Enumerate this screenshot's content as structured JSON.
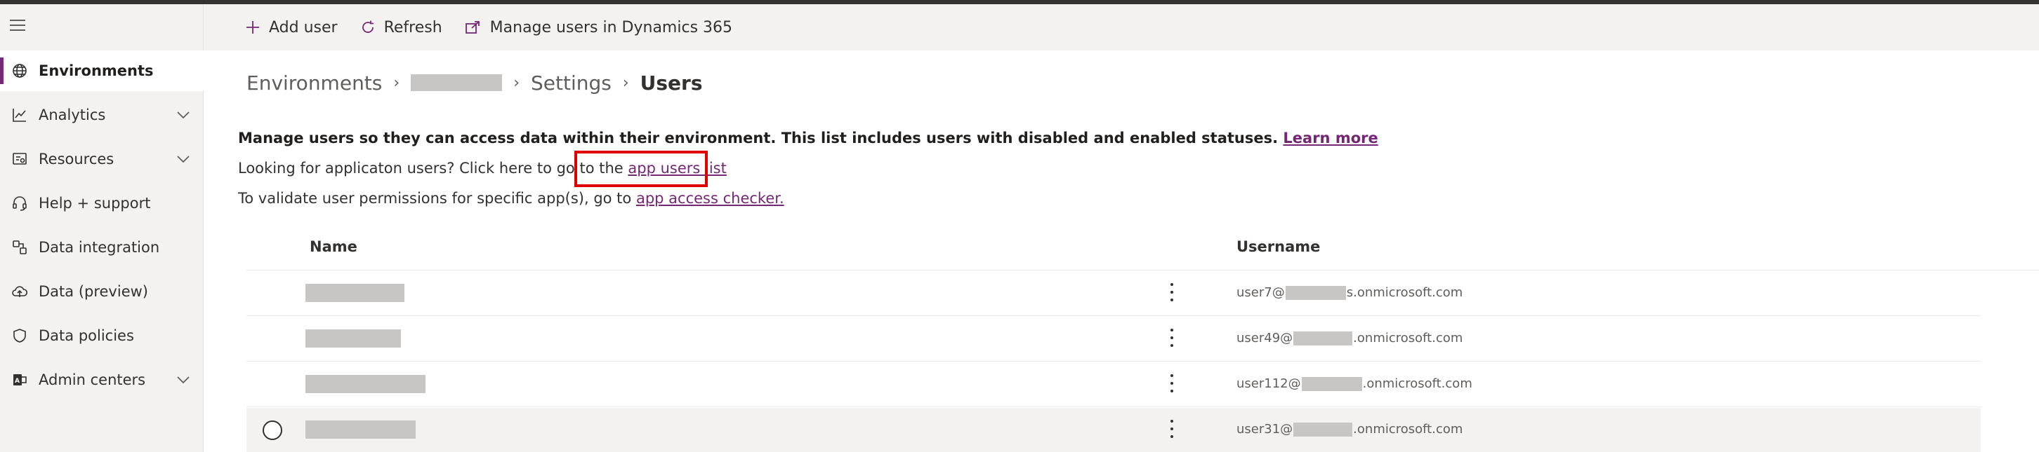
{
  "nav": {
    "items": [
      {
        "label": "Environments",
        "icon": "globe-icon",
        "active": true,
        "expandable": false
      },
      {
        "label": "Analytics",
        "icon": "chart-line-icon",
        "active": false,
        "expandable": true
      },
      {
        "label": "Resources",
        "icon": "resources-icon",
        "active": false,
        "expandable": true
      },
      {
        "label": "Help + support",
        "icon": "headset-icon",
        "active": false,
        "expandable": false
      },
      {
        "label": "Data integration",
        "icon": "data-integration-icon",
        "active": false,
        "expandable": false
      },
      {
        "label": "Data (preview)",
        "icon": "cloud-icon",
        "active": false,
        "expandable": false
      },
      {
        "label": "Data policies",
        "icon": "shield-icon",
        "active": false,
        "expandable": false
      },
      {
        "label": "Admin centers",
        "icon": "admin-icon",
        "active": false,
        "expandable": true
      }
    ]
  },
  "toolbar": {
    "add_user": "Add user",
    "refresh": "Refresh",
    "manage_users": "Manage users in Dynamics 365"
  },
  "breadcrumb": {
    "root": "Environments",
    "settings": "Settings",
    "current": "Users"
  },
  "intro": {
    "main": "Manage users so they can access data within their environment. This list includes users with disabled and enabled statuses.",
    "learn_more": "Learn more",
    "app_users_prefix": "Looking for applicaton users? Click here to go to the",
    "app_users_link": "app users list",
    "validate_prefix": "To validate user permissions for specific app(s), go to",
    "validate_link": "app access checker."
  },
  "table": {
    "columns": {
      "name": "Name",
      "username": "Username"
    },
    "rows": [
      {
        "user_prefix": "user7@",
        "user_suffix": "s.onmicrosoft.com",
        "selected": false
      },
      {
        "user_prefix": "user49@",
        "user_suffix": ".onmicrosoft.com",
        "selected": false
      },
      {
        "user_prefix": "user112@",
        "user_suffix": ".onmicrosoft.com",
        "selected": false
      },
      {
        "user_prefix": "user31@",
        "user_suffix": ".onmicrosoft.com",
        "selected": false
      }
    ]
  },
  "colors": {
    "accent": "#742774",
    "highlight_box": "#e00000",
    "redaction": "#c8c6c4"
  }
}
